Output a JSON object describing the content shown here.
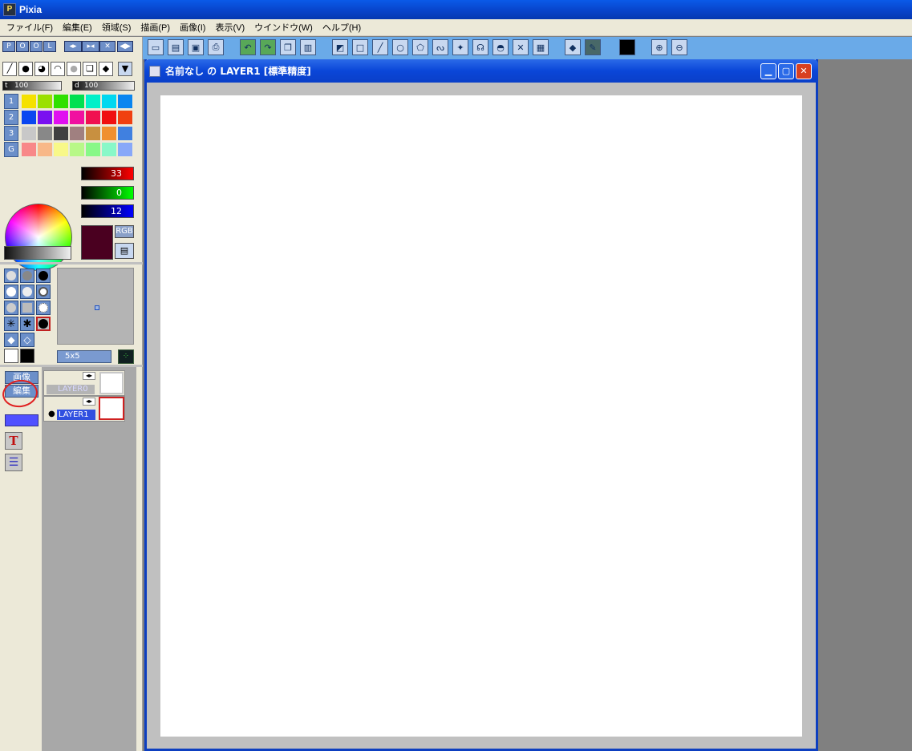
{
  "app": {
    "title": "Pixia",
    "icon": "pixia-app-icon"
  },
  "menu": [
    "ファイル(F)",
    "編集(E)",
    "領域(S)",
    "描画(P)",
    "画像(I)",
    "表示(V)",
    "ウインドウ(W)",
    "ヘルプ(H)"
  ],
  "pool_buttons": [
    "P",
    "O",
    "O",
    "L"
  ],
  "tool_params": {
    "t_label": "t",
    "t_value": "100",
    "d_label": "d",
    "d_value": "100"
  },
  "palette_rows": [
    "1",
    "2",
    "3",
    "G"
  ],
  "palette_colors": [
    [
      "#f5e100",
      "#9be000",
      "#2fe000",
      "#00e050",
      "#00f0c8",
      "#00d8f0",
      "#0a86f0"
    ],
    [
      "#0a46f0",
      "#7a10f0",
      "#e010f0",
      "#f010a0",
      "#f01050",
      "#f01010",
      "#f04010"
    ],
    [
      "#c8c8c8",
      "#888888",
      "#404040",
      "#a08080",
      "#c89040",
      "#f09030",
      "#4080e0"
    ],
    [
      "#f88888",
      "#f8b888",
      "#f8f888",
      "#b8f888",
      "#88f888",
      "#88f8c8",
      "#88a8f8"
    ]
  ],
  "color": {
    "r": "33",
    "g": "0",
    "b": "12",
    "mode_label": "RGB",
    "current": "#4a0020"
  },
  "brush": {
    "size_label": "5x5"
  },
  "sidebar_tabs": {
    "image": "画像",
    "edit": "編集"
  },
  "layers": [
    {
      "name": "LAYER0"
    },
    {
      "name": "LAYER1"
    }
  ],
  "document": {
    "title": "名前なし の LAYER1 [標準精度]"
  }
}
